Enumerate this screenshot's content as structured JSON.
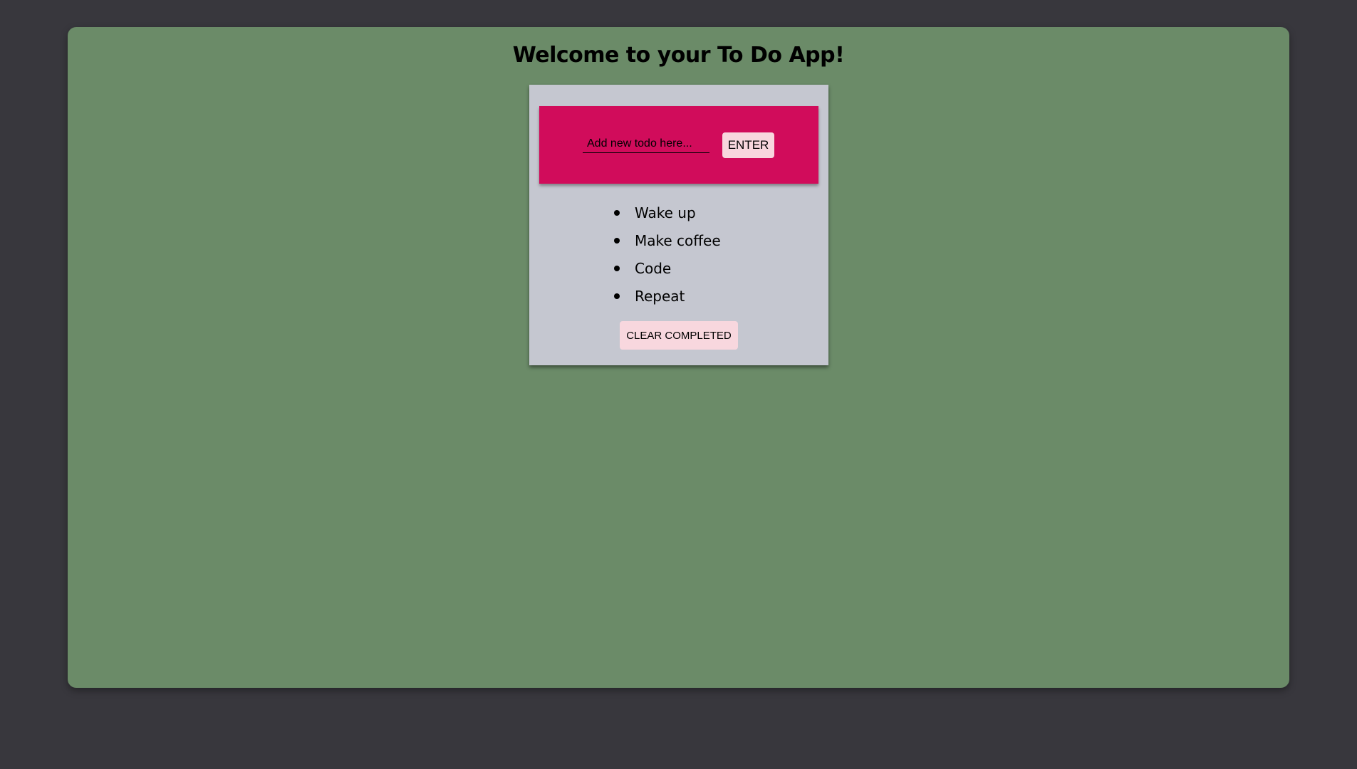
{
  "header": {
    "title": "Welcome to your To Do App!"
  },
  "input_bar": {
    "placeholder": "Add new todo here...",
    "value": "",
    "enter_label": "ENTER"
  },
  "todos": [
    {
      "text": "Wake up"
    },
    {
      "text": "Make coffee"
    },
    {
      "text": "Code"
    },
    {
      "text": "Repeat"
    }
  ],
  "actions": {
    "clear_completed_label": "CLEAR COMPLETED"
  },
  "colors": {
    "background": "#38373d",
    "frame": "#6b8b68",
    "card": "#c5c7d0",
    "accent": "#d10c5b",
    "button": "#f8d7de"
  }
}
